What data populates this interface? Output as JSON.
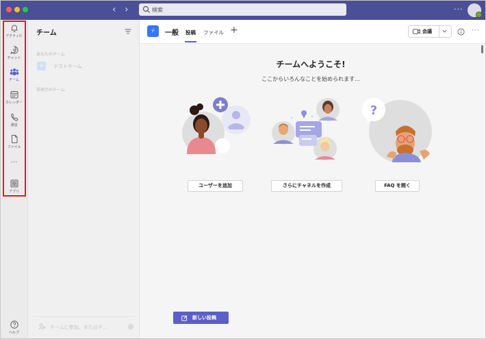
{
  "titlebar": {
    "search_placeholder": "検索"
  },
  "rail": {
    "items": [
      {
        "label": "アクティビ",
        "icon": "bell-icon"
      },
      {
        "label": "チャット",
        "icon": "chat-icon"
      },
      {
        "label": "チーム",
        "icon": "teams-icon"
      },
      {
        "label": "カレンダー",
        "icon": "calendar-icon"
      },
      {
        "label": "通話",
        "icon": "phone-icon"
      },
      {
        "label": "ファイル",
        "icon": "file-icon"
      },
      {
        "label": "アプリ",
        "icon": "apps-icon"
      }
    ],
    "more": "…",
    "help_label": "ヘルプ"
  },
  "teams": {
    "title": "チーム",
    "your_teams_heading": "あなたのチーム",
    "team_list": [
      {
        "name": "テストチーム",
        "initial": "テ"
      }
    ],
    "hidden_teams_heading": "非表示のチーム",
    "join_text": "チームに参加、またはチ..."
  },
  "channel": {
    "avatar_initial": "テ",
    "name": "一般",
    "tabs": [
      {
        "label": "投稿",
        "active": true
      },
      {
        "label": "ファイル",
        "active": false
      }
    ],
    "add_tab": "+",
    "meet_label": "会議"
  },
  "welcome": {
    "title": "チームへようこそ!",
    "subtitle": "ここからいろんなことを始められます...",
    "actions": [
      {
        "label": "ユーザーを追加"
      },
      {
        "label": "さらにチャネルを作成"
      },
      {
        "label": "FAQ を開く"
      }
    ],
    "new_post_label": "新しい投稿"
  },
  "colors": {
    "titlebar": "#4b4f95",
    "accent": "#5b5fc7",
    "highlight_box": "#e21d1d"
  }
}
